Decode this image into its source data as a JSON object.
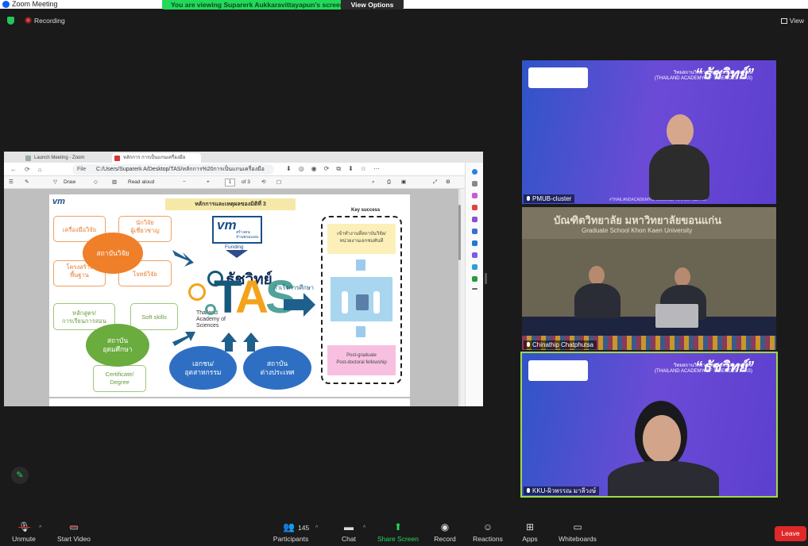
{
  "window": {
    "title": "Zoom Meeting"
  },
  "share_banner": {
    "message": "You are viewing Suparerk Aukkaravittayapun's screen",
    "view_options": "View Options"
  },
  "top_info": {
    "recording": "Recording",
    "view": "View"
  },
  "browser": {
    "tabs": [
      {
        "label": "Launch Meeting - Zoom"
      },
      {
        "label": "หลักการ การเป็นแกนเครื่องมือสนับสนุน..."
      }
    ],
    "file_label": "File",
    "url": "C:/Users/Suparerk A/Desktop/TAS/หลักการ%20การเป็นแกนเครื่องมือสนับสนุน..."
  },
  "pdf_toolbar": {
    "draw": "Draw",
    "read_aloud": "Read aloud",
    "page": "1",
    "page_total": "of 3",
    "zoom_minus": "−",
    "zoom_plus": "+"
  },
  "slide": {
    "title": "หลักการและเหตุผลของมิติที่ 3",
    "logo_text": "vm",
    "orange_boxes": [
      "เครื่องมือวิจัย",
      "นักวิจัย\nผู้เชี่ยวชาญ",
      "โครงสร้าง\nพื้นฐาน",
      "โจทย์วิจัย"
    ],
    "orange_circle": "สถาบันวิจัย",
    "green_boxes": [
      "หลักสูตร/\nการเรียนการสอน",
      "Soft skills",
      "Certificate/\nDegree"
    ],
    "green_circle": "สถาบัน\nอุดมศึกษา",
    "funding": "Funding",
    "fund_logo_text": "สร้างคน\nจำนพรมแดน",
    "brand": "ธัชวิทย์",
    "tas_t": "T",
    "tas_a": "A",
    "tas_s": "S",
    "academy": "Thailand\nAcademy of\nSciences",
    "blue_circles": [
      "เอกชน/\nอุตสาหกรรม",
      "สถาบัน\nต่างประเทศ"
    ],
    "success_text": "สำเร็จการศึกษา",
    "key_success": {
      "title": "Key success",
      "top": "เข้าทำงานที่สถาบันวิจัย/\nหน่วยงานเอกชนทันที",
      "bottom": "Post-graduate\nPost-doctoral fellowship"
    }
  },
  "video_tiles": [
    {
      "name": "PMUB-cluster",
      "banner_title": "“ธัชวิทย์”",
      "banner_sub": "วิทยสถานวิทยาศาสตร์แห่งประเทศไทย\n(THAILAND ACADEMY OF SCIENCES : TAS)",
      "footer": "#THAILANDACADEMYOFSCIENCE #ธัชวิทย์ #tas #วิท"
    },
    {
      "name": "Chinathip Chatphutsa",
      "banner_title": "บัณฑิตวิทยาลัย มหาวิทยาลัยขอนแก่น",
      "banner_sub": "Graduate School Khon Kaen University"
    },
    {
      "name": "KKU-ผิวพรรณ มาลีวงษ์",
      "banner_title": "“ธัชวิทย์”",
      "banner_sub": "วิทยสถานวิทยาศาสตร์แห่งประเทศไทย\n(THAILAND ACADEMY OF SCIENCES : TAS)"
    }
  ],
  "toolbar": {
    "unmute": "Unmute",
    "start_video": "Start Video",
    "participants": "Participants",
    "participants_count": "145",
    "chat": "Chat",
    "share_screen": "Share Screen",
    "record": "Record",
    "reactions": "Reactions",
    "apps": "Apps",
    "whiteboards": "Whiteboards",
    "leave": "Leave"
  },
  "colors": {
    "accent_green": "#23d959",
    "leave_red": "#e02828",
    "zoom_blue": "#0b5cff"
  }
}
